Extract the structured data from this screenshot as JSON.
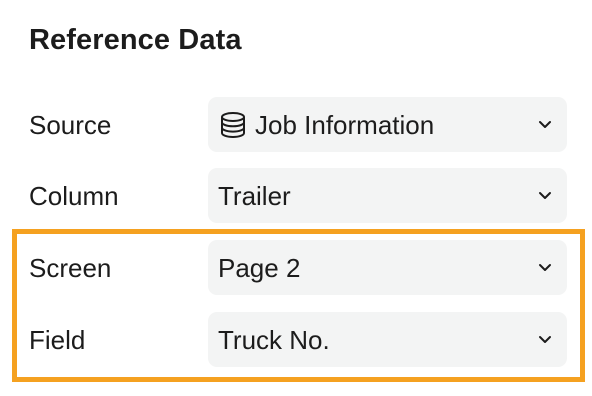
{
  "section": {
    "title": "Reference Data"
  },
  "rows": [
    {
      "label": "Source",
      "value": "Job Information",
      "icon": "database-icon"
    },
    {
      "label": "Column",
      "value": "Trailer"
    },
    {
      "label": "Screen",
      "value": "Page 2"
    },
    {
      "label": "Field",
      "value": "Truck No."
    }
  ],
  "highlight": {
    "color": "#f5a120"
  },
  "colors": {
    "select_background": "#f3f4f4",
    "text": "#1c1c1c"
  }
}
